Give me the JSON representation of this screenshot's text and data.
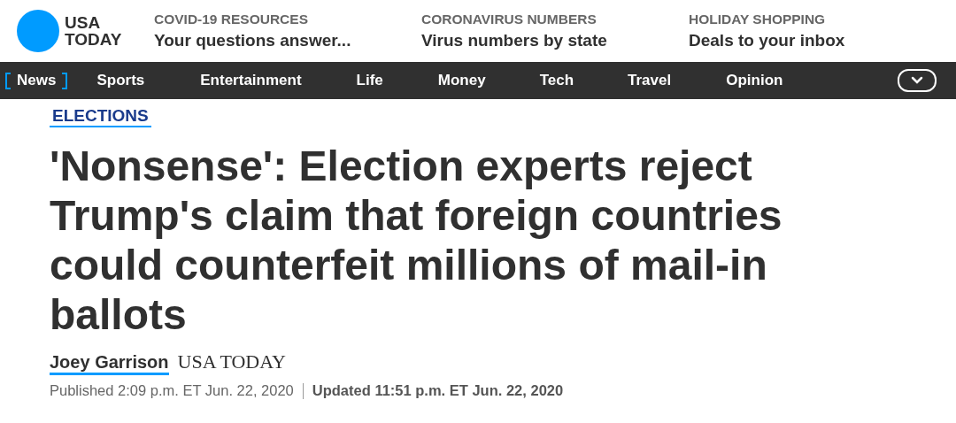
{
  "logo": {
    "line_1": "USA",
    "line_2": "TODAY"
  },
  "promos": [
    {
      "label": "COVID-19 RESOURCES",
      "headline": "Your questions answer..."
    },
    {
      "label": "CORONAVIRUS NUMBERS",
      "headline": "Virus numbers by state"
    },
    {
      "label": "HOLIDAY SHOPPING",
      "headline": "Deals to your inbox"
    }
  ],
  "nav": [
    {
      "label": "News",
      "selected": true
    },
    {
      "label": "Sports",
      "selected": false
    },
    {
      "label": "Entertainment",
      "selected": false
    },
    {
      "label": "Life",
      "selected": false
    },
    {
      "label": "Money",
      "selected": false
    },
    {
      "label": "Tech",
      "selected": false
    },
    {
      "label": "Travel",
      "selected": false
    },
    {
      "label": "Opinion",
      "selected": false
    }
  ],
  "article": {
    "section": "ELECTIONS",
    "headline": "'Nonsense': Election experts reject Trump's claim that foreign countries could counterfeit millions of mail-in ballots",
    "author": "Joey Garrison",
    "outlet": "USA TODAY",
    "published": "Published 2:09 p.m. ET Jun. 22, 2020",
    "updated": "Updated 11:51 p.m. ET Jun. 22, 2020"
  }
}
